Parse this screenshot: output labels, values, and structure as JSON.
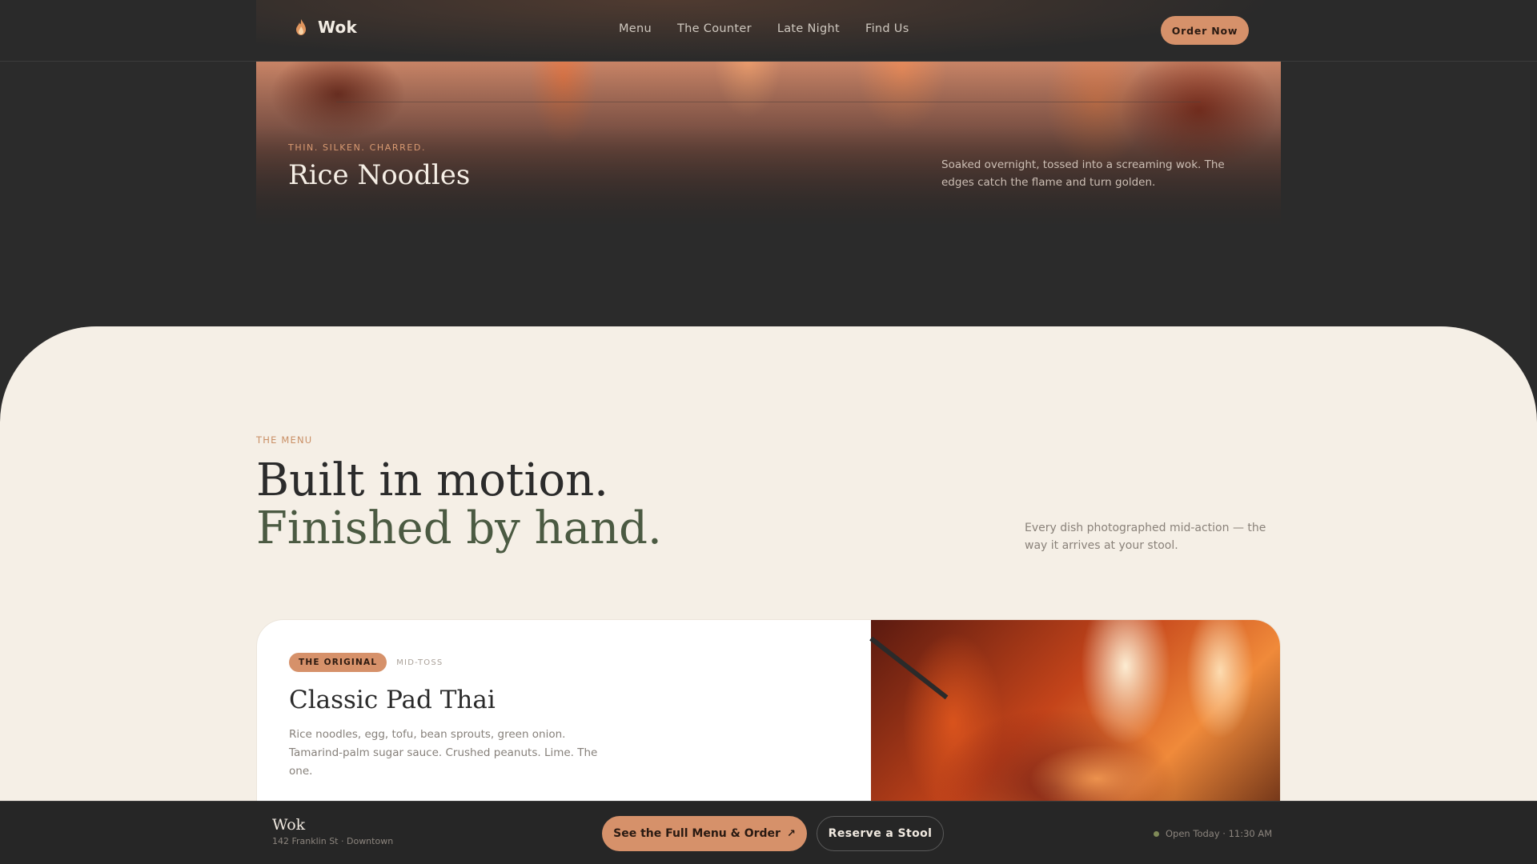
{
  "nav": {
    "brand": "Wok",
    "links": [
      "Menu",
      "The Counter",
      "Late Night",
      "Find Us"
    ],
    "order_label": "Order Now"
  },
  "hero": {
    "kicker": "THIN. SILKEN. CHARRED.",
    "title": "Rice Noodles",
    "description": "Soaked overnight, tossed into a screaming wok. The edges catch the flame and turn golden."
  },
  "menu": {
    "kicker": "THE MENU",
    "headline_1": "Built in motion.",
    "headline_2": "Finished by hand.",
    "note": "Every dish photographed mid-action — the way it arrives at your stool."
  },
  "dish": {
    "badge": "THE ORIGINAL",
    "tag": "MID-TOSS",
    "title": "Classic Pad Thai",
    "description": "Rice noodles, egg, tofu, bean sprouts, green onion. Tamarind-palm sugar sauce. Crushed peanuts. Lime. The one."
  },
  "bottom_bar": {
    "name": "Wok",
    "address": "142 Franklin St · Downtown",
    "cta_label": "See the Full Menu & Order",
    "cta_icon": "↗",
    "reserve_label": "Reserve a Stool",
    "status": "Open Today · 11:30 AM"
  },
  "colors": {
    "accent": "#d6916a",
    "dark_bg": "#2b2b2b",
    "cream_bg": "#f5efe6",
    "olive": "#4b5a42"
  }
}
